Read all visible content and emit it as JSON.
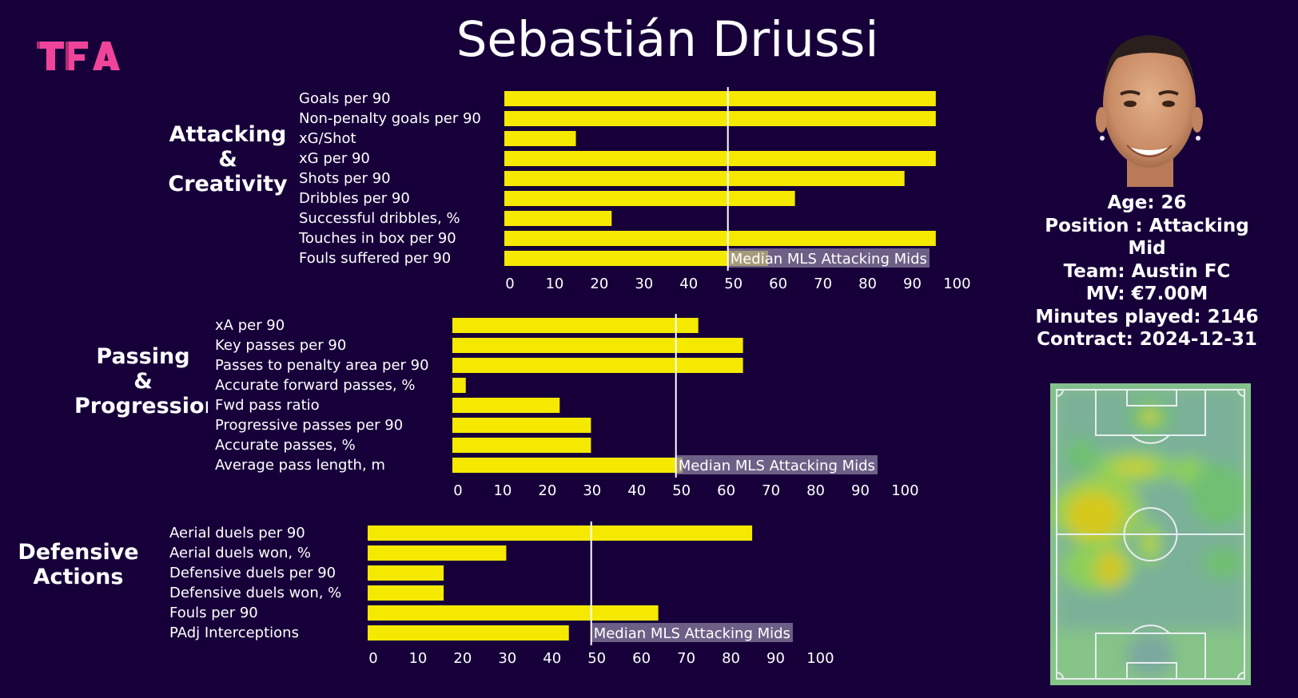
{
  "brand": {
    "logo_text": "TFA",
    "logo_color": "#f0449a"
  },
  "title": "Sebastián Driussi",
  "colors": {
    "background": "#17003a",
    "bar": "#f5e900",
    "median_line": "#ffffff",
    "median_box": "#8b7fa0",
    "text": "#ffffff"
  },
  "profile": {
    "age": "Age: 26",
    "position_line1": "Position : Attacking",
    "position_line2": "Mid",
    "team": "Team: Austin FC",
    "market_value": "MV: €7.00M",
    "minutes": "Minutes played: 2146",
    "contract": "Contract: 2024-12-31"
  },
  "photo": {
    "description": "player-headshot"
  },
  "heatmap": {
    "description": "player-touch-heatmap",
    "pitch_color": "#86c487"
  },
  "chart_data": [
    {
      "type": "bar",
      "orientation": "horizontal",
      "section_title": [
        "Attacking",
        "&",
        "Creativity"
      ],
      "categories": [
        "Goals per 90",
        "Non-penalty goals per 90",
        "xG/Shot",
        "xG per 90",
        "Shots per 90",
        "Dribbles per 90",
        "Successful dribbles, %",
        "Touches in box per 90",
        "Fouls suffered per 90"
      ],
      "values": [
        96.5,
        96.5,
        16,
        96.5,
        89.5,
        65,
        24,
        96.5,
        59
      ],
      "reference_line": {
        "value": 50,
        "label": "Median MLS Attacking Mids"
      },
      "xlim": [
        0,
        100
      ],
      "xticks": [
        "0",
        "10",
        "20",
        "30",
        "40",
        "50",
        "60",
        "70",
        "80",
        "90",
        "100"
      ],
      "unit": "percentile"
    },
    {
      "type": "bar",
      "orientation": "horizontal",
      "section_title": [
        "Passing",
        "&",
        "Progression"
      ],
      "categories": [
        "xA per 90",
        "Key passes per 90",
        "Passes to penalty area per 90",
        "Accurate forward passes, %",
        "Fwd pass ratio",
        "Progressive passes per 90",
        "Accurate passes, %",
        "Average pass length, m"
      ],
      "values": [
        55,
        65,
        65,
        3,
        24,
        31,
        31,
        51.5
      ],
      "reference_line": {
        "value": 50,
        "label": "Median MLS Attacking Mids"
      },
      "xlim": [
        0,
        100
      ],
      "xticks": [
        "0",
        "10",
        "20",
        "30",
        "40",
        "50",
        "60",
        "70",
        "80",
        "90",
        "100"
      ],
      "unit": "percentile"
    },
    {
      "type": "bar",
      "orientation": "horizontal",
      "section_title": [
        "Defensive",
        "Actions"
      ],
      "categories": [
        "Aerial duels per 90",
        "Aerial duels won, %",
        "Defensive duels per 90",
        "Defensive duels won, %",
        "Fouls per 90",
        "PAdj Interceptions"
      ],
      "values": [
        86,
        31,
        17,
        17,
        65,
        45
      ],
      "reference_line": {
        "value": 50,
        "label": "Median MLS Attacking Mids"
      },
      "xlim": [
        0,
        100
      ],
      "xticks": [
        "0",
        "10",
        "20",
        "30",
        "40",
        "50",
        "60",
        "70",
        "80",
        "90",
        "100"
      ],
      "unit": "percentile"
    }
  ]
}
